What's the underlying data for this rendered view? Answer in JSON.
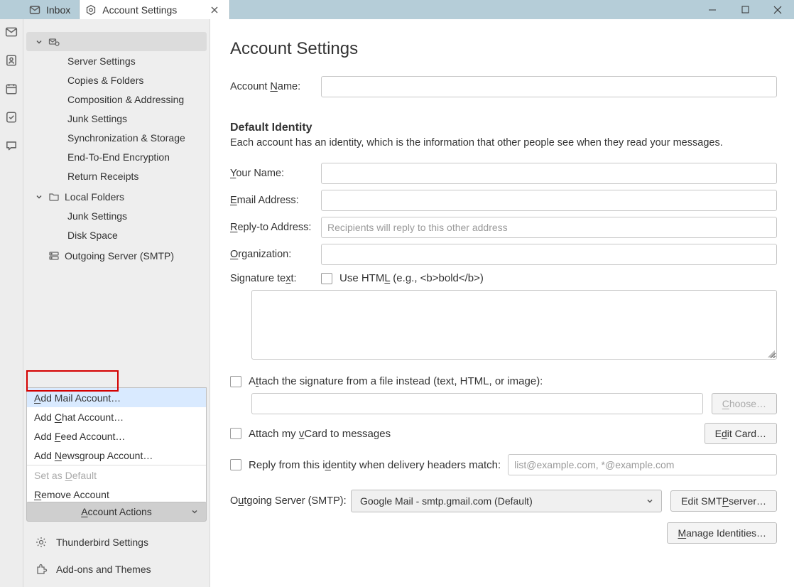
{
  "tabs": {
    "inbox": "Inbox",
    "settings": "Account Settings"
  },
  "tree": {
    "account_items": [
      "Server Settings",
      "Copies & Folders",
      "Composition & Addressing",
      "Junk Settings",
      "Synchronization & Storage",
      "End-To-End Encryption",
      "Return Receipts"
    ],
    "local_folders_label": "Local Folders",
    "local_items": [
      "Junk Settings",
      "Disk Space"
    ],
    "outgoing_label": "Outgoing Server (SMTP)"
  },
  "account_actions": {
    "button": "Account Actions",
    "items": {
      "add_mail": "Add Mail Account…",
      "add_chat": "Add Chat Account…",
      "add_feed": "Add Feed Account…",
      "add_news": "Add Newsgroup Account…",
      "set_default": "Set as Default",
      "remove": "Remove Account"
    }
  },
  "footer": {
    "settings": "Thunderbird Settings",
    "addons": "Add-ons and Themes"
  },
  "main": {
    "title": "Account Settings",
    "account_name_label": "Account Name:",
    "default_identity_title": "Default Identity",
    "default_identity_desc": "Each account has an identity, which is the information that other people see when they read your messages.",
    "your_name": "Your Name:",
    "email": "Email Address:",
    "reply_to": "Reply-to Address:",
    "reply_to_placeholder": "Recipients will reply to this other address",
    "organization": "Organization:",
    "signature_text": "Signature text:",
    "use_html": "Use HTML (e.g., <b>bold</b>)",
    "attach_file": "Attach the signature from a file instead (text, HTML, or image):",
    "choose": "Choose…",
    "attach_vcard": "Attach my vCard to messages",
    "edit_card": "Edit Card…",
    "reply_identity": "Reply from this identity when delivery headers match:",
    "reply_identity_placeholder": "list@example.com, *@example.com",
    "outgoing_server_label": "Outgoing Server (SMTP):",
    "outgoing_server_value": "Google Mail - smtp.gmail.com (Default)",
    "edit_smtp": "Edit SMTP server…",
    "manage_identities": "Manage Identities…"
  }
}
